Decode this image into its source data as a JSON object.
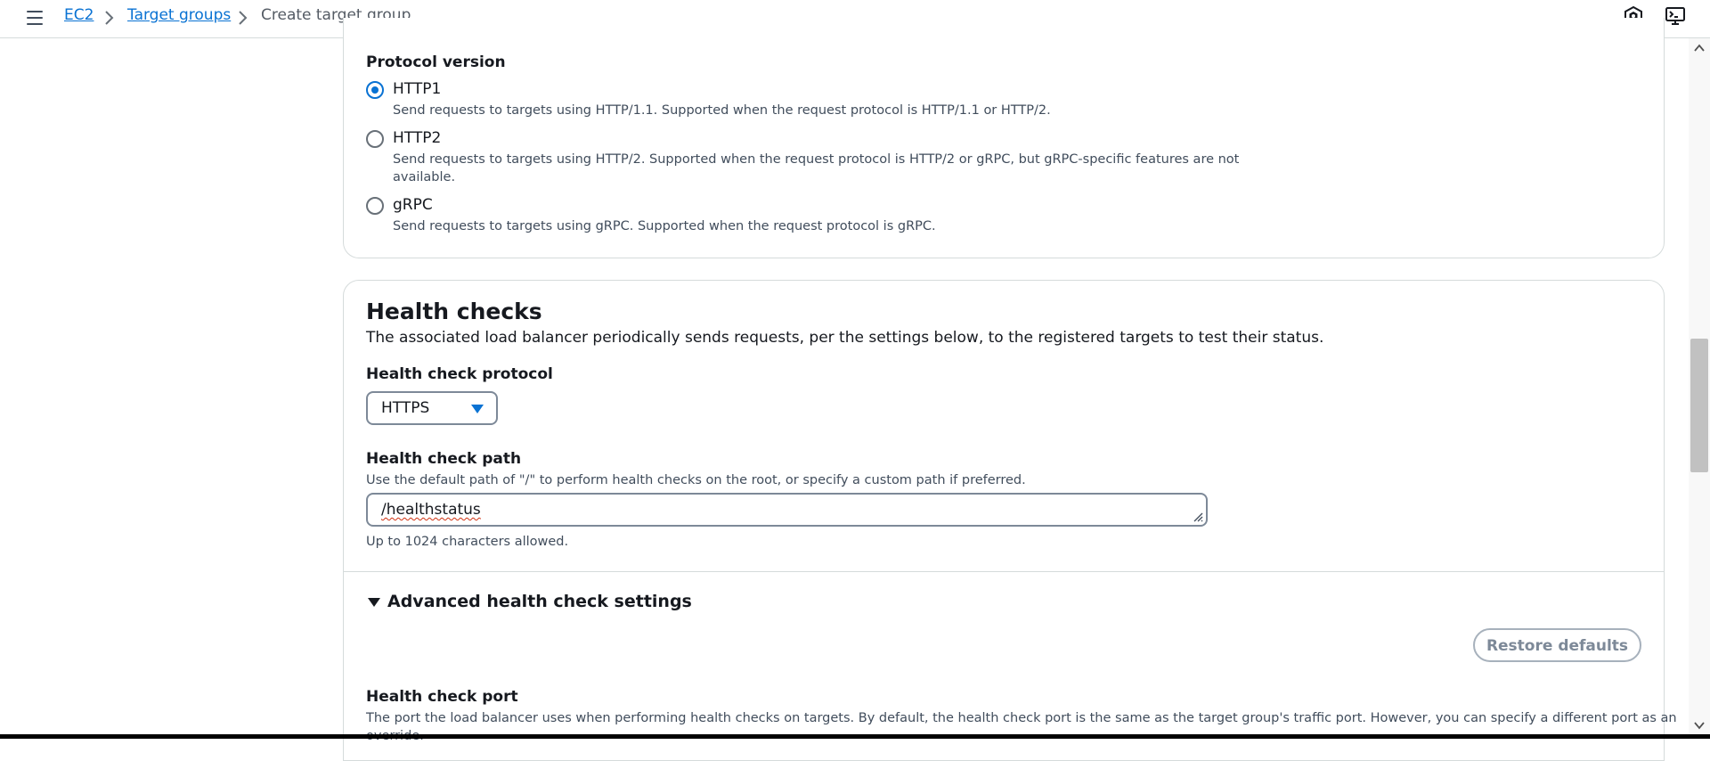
{
  "breadcrumb": {
    "items": [
      {
        "label": "EC2"
      },
      {
        "label": "Target groups"
      }
    ],
    "current": "Create target group"
  },
  "top_icons": [
    "settings-hex-icon",
    "cloudshell-icon"
  ],
  "protocol_version": {
    "label": "Protocol version",
    "selected": "HTTP1",
    "options": [
      {
        "label": "HTTP1",
        "description": "Send requests to targets using HTTP/1.1. Supported when the request protocol is HTTP/1.1 or HTTP/2."
      },
      {
        "label": "HTTP2",
        "description_line1": "Send requests to targets using HTTP/2. Supported when the request protocol is HTTP/2 or gRPC, but gRPC-specific features are not",
        "description_line2": "available."
      },
      {
        "label": "gRPC",
        "description": "Send requests to targets using gRPC. Supported when the request protocol is gRPC."
      }
    ]
  },
  "health_checks": {
    "title": "Health checks",
    "description": "The associated load balancer periodically sends requests, per the settings below, to the registered targets to test their status.",
    "protocol": {
      "label": "Health check protocol",
      "value": "HTTPS"
    },
    "path": {
      "label": "Health check path",
      "description": "Use the default path of \"/\" to perform health checks on the root, or specify a custom path if preferred.",
      "value": "/healthstatus",
      "constraint": "Up to 1024 characters allowed."
    },
    "advanced": {
      "label": "Advanced health check settings",
      "expanded": true,
      "restore_button": "Restore defaults",
      "port": {
        "label": "Health check port",
        "description_line1": "The port the load balancer uses when performing health checks on targets. By default, the health check port is the same as the target group's traffic port. However, you can specify a different port as an",
        "description_line2": "override."
      }
    }
  },
  "colors": {
    "accent": "#0972d3",
    "text": "#16191f",
    "border": "#d5dbdb"
  }
}
